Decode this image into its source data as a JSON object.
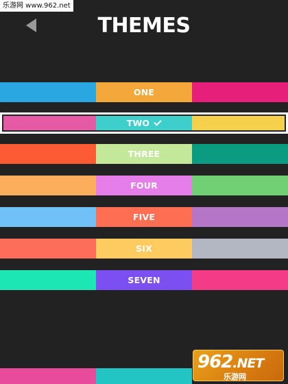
{
  "watermark_top": "乐游网 www.962.net",
  "watermark_logo": {
    "number": "962",
    "suffix": ".NET",
    "cn": "乐游网"
  },
  "header": {
    "title": "THEMES",
    "back_icon": "back-triangle-icon"
  },
  "themes": [
    {
      "label": "ONE",
      "selected": false,
      "colors": [
        "#2aa6e0",
        "#f5a83a",
        "#e6207a"
      ]
    },
    {
      "label": "TWO",
      "selected": true,
      "colors": [
        "#e45aa4",
        "#3ecfcb",
        "#f4d04c"
      ]
    },
    {
      "label": "THREE",
      "selected": false,
      "colors": [
        "#fc5b33",
        "#c3e89a",
        "#0a9b80"
      ]
    },
    {
      "label": "FOUR",
      "selected": false,
      "colors": [
        "#fdae5c",
        "#e57ee8",
        "#6fd074"
      ]
    },
    {
      "label": "FIVE",
      "selected": false,
      "colors": [
        "#71c1f6",
        "#fd6e53",
        "#b576c8"
      ]
    },
    {
      "label": "SIX",
      "selected": false,
      "colors": [
        "#fc6e59",
        "#fdcb60",
        "#b3b7c2"
      ]
    },
    {
      "label": "SEVEN",
      "selected": false,
      "colors": [
        "#1ce6b4",
        "#7c4ff0",
        "#f23c87"
      ]
    }
  ],
  "partial_row_colors": [
    "#e84b9a",
    "#22c5c3",
    "#222222"
  ],
  "selected_check_icon": "checkmark-icon"
}
